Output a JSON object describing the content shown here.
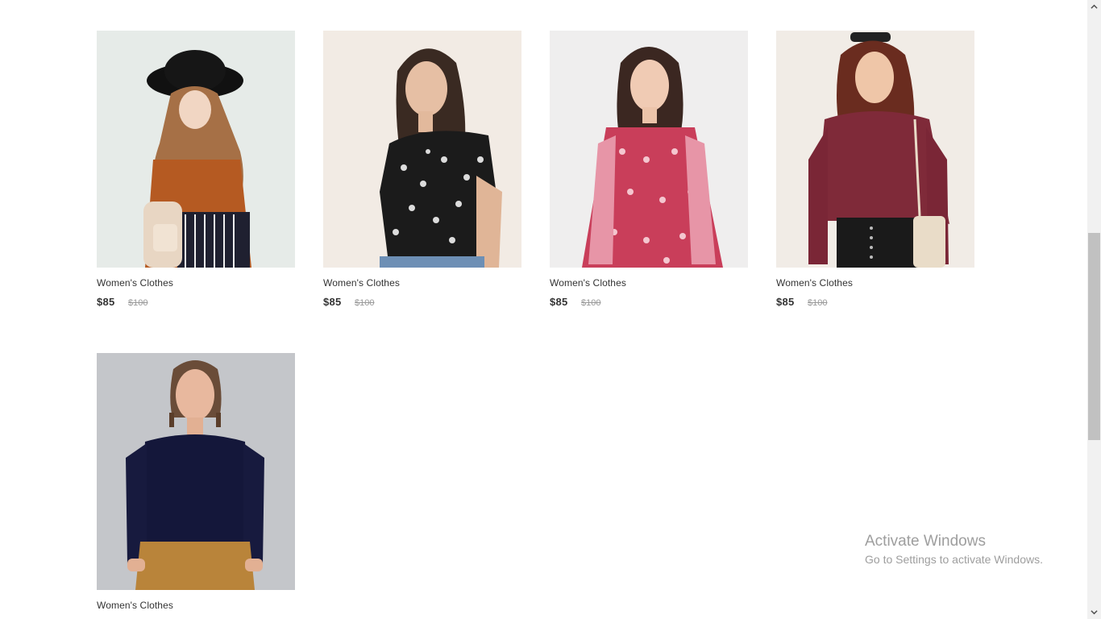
{
  "products": [
    {
      "name": "Women's Clothes",
      "price": "$85",
      "old_price": "$100",
      "image": "model-hijab-black-hat-orange-top"
    },
    {
      "name": "Women's Clothes",
      "price": "$85",
      "old_price": "$100",
      "image": "model-black-floral-blouse"
    },
    {
      "name": "Women's Clothes",
      "price": "$85",
      "old_price": "$100",
      "image": "model-red-floral-dress"
    },
    {
      "name": "Women's Clothes",
      "price": "$85",
      "old_price": "$100",
      "image": "model-burgundy-hoodie-leather-skirt"
    },
    {
      "name": "Women's Clothes",
      "image": "model-navy-sweater-tan-trousers"
    }
  ],
  "watermark": {
    "title": "Activate Windows",
    "subtitle": "Go to Settings to activate Windows."
  },
  "colors": {
    "price_text": "#333333",
    "old_price_text": "#999999",
    "watermark_text": "#9e9e9e"
  },
  "icons": {
    "scroll_up": "chevron-up-icon",
    "scroll_down": "chevron-down-icon"
  }
}
